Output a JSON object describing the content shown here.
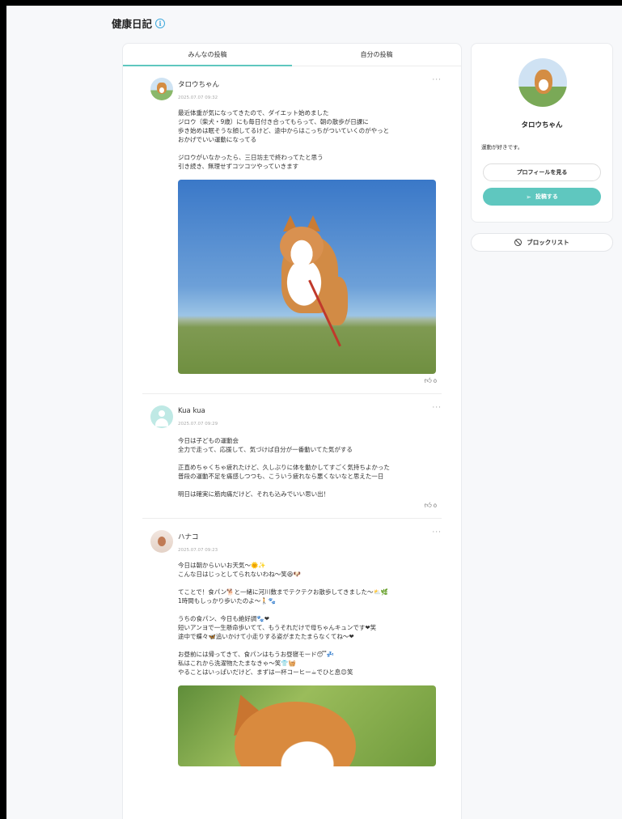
{
  "header": {
    "title": "健康日記",
    "info_icon": "info-icon"
  },
  "tabs": [
    {
      "label": "みんなの投稿",
      "active": true
    },
    {
      "label": "自分の投稿",
      "active": false
    }
  ],
  "posts": [
    {
      "username": "タロウちゃん",
      "timestamp": "2025.07.07 09:32",
      "paragraphs": [
        "最近体重が気になってきたので、ダイエット始めました\nジロウ（柴犬・9歳）にも毎日付き合ってもらって、朝の散歩が日課に\n歩き始めは眠そうな顔してるけど、途中からはこっちがついていくのがやっと\nおかげでいい運動になってる",
        "ジロウがいなかったら、三日坊主で終わってたと思う\n引き続き、無理せずコツコツやっていきます"
      ],
      "has_photo": true,
      "likes": "0"
    },
    {
      "username": "Kua kua",
      "timestamp": "2025.07.07 09:29",
      "paragraphs": [
        "今日は子どもの運動会\n全力で走って、応援して、気づけば自分が一番動いてた気がする",
        "正直めちゃくちゃ疲れたけど、久しぶりに体を動かしてすごく気持ちよかった\n普段の運動不足を痛感しつつも、こういう疲れなら悪くないなと思えた一日",
        "明日は確実に筋肉痛だけど、それも込みでいい思い出！"
      ],
      "likes": "0"
    },
    {
      "username": "ハナコ",
      "timestamp": "2025.07.07 09:23",
      "paragraphs": [
        "今日は朝からいいお天気〜🌞✨\nこんな日はじっとしてられないわね〜笑😆🐶",
        "てことで！食パン🐕と一緒に河川敷までテクテクお散歩してきました〜⛅🌿\n1時間もしっかり歩いたのよ〜🚶🐾",
        "うちの食パン、今日も絶好調🐾❤\n短いアンヨで一生懸命歩いてて、もうそれだけで母ちゃんキュンです❤笑\n途中で蝶々🦋追いかけて小走りする姿がまたたまらなくてね〜❤",
        "お昼前には帰ってきて、食パンはもうお昼寝モード😴💤\n私はこれから洗濯物たたまなきゃ〜笑👕🧺\nやることはいっぱいだけど、まずは一杯コーヒー☕でひと息😊笑"
      ]
    }
  ],
  "profile": {
    "name": "タロウちゃん",
    "bio": "運動が好きです。",
    "view_profile_label": "プロフィールを見る",
    "post_label": "投稿する"
  },
  "block_list_label": "ブロックリスト",
  "colors": {
    "accent": "#5fc7bf",
    "info": "#3fa9dc"
  }
}
